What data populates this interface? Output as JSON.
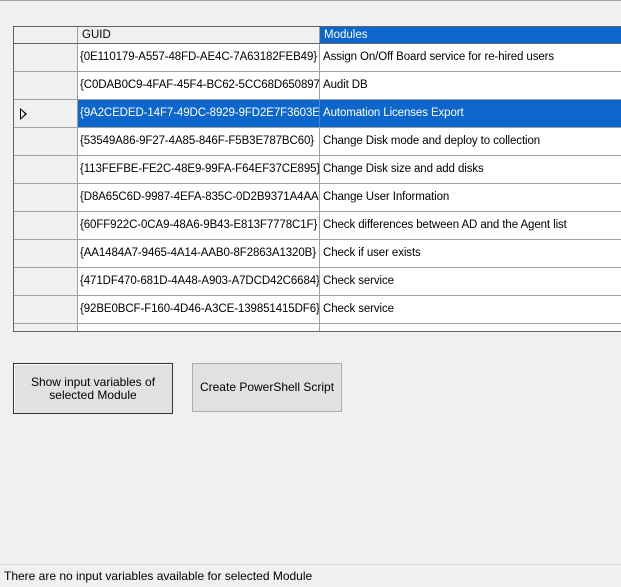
{
  "grid": {
    "columns": [
      "GUID",
      "Modules"
    ],
    "rows": [
      {
        "guid": "{0E110179-A557-48FD-AE4C-7A63182FEB49}",
        "module": "Assign On/Off Board service for re-hired users"
      },
      {
        "guid": "{C0DAB0C9-4FAF-45F4-BC62-5CC68D650897}",
        "module": "Audit DB"
      },
      {
        "guid": "{9A2CEDED-14F7-49DC-8929-9FD2E7F3603E}",
        "module": "Automation Licenses Export"
      },
      {
        "guid": "{53549A86-9F27-4A85-846F-F5B3E787BC60}",
        "module": "Change Disk mode and deploy to collection"
      },
      {
        "guid": "{113FEFBE-FE2C-48E9-99FA-F64EF37CE895}",
        "module": "Change Disk size and add disks"
      },
      {
        "guid": "{D8A65C6D-9987-4EFA-835C-0D2B9371A4AA}",
        "module": "Change User Information"
      },
      {
        "guid": "{60FF922C-0CA9-48A6-9B43-E813F7778C1F}",
        "module": "Check differences between AD and the Agent list"
      },
      {
        "guid": "{AA1484A7-9465-4A14-AAB0-8F2863A1320B}",
        "module": "Check if user exists"
      },
      {
        "guid": "{471DF470-681D-4A48-A903-A7DCD42C6684}",
        "module": "Check service"
      },
      {
        "guid": "{92BE0BCF-F160-4D46-A3CE-139851415DF6}",
        "module": "Check service"
      }
    ],
    "selected_index": 2,
    "selection_color": "#0C66CC"
  },
  "buttons": {
    "show_input": "Show input variables of selected Module",
    "create_script": "Create PowerShell Script"
  },
  "status": {
    "text": "There are no input variables available for selected Module"
  }
}
